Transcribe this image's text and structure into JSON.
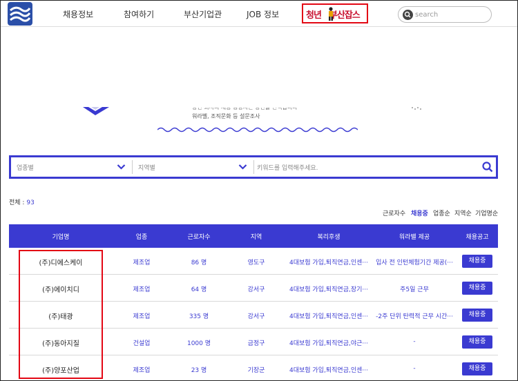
{
  "nav": {
    "items": [
      "채용정보",
      "참여하기",
      "부산기업관",
      "JOB 정보"
    ],
    "highlight_left": "청년",
    "highlight_right": "부산잡스"
  },
  "search": {
    "placeholder": "search"
  },
  "banner": {
    "line1": "당신 회사의 채용 담당자는 당신을 선택합니다",
    "line2": "워라벨, 조직문화 등 설문조사"
  },
  "filter": {
    "industry_placeholder": "업종별",
    "region_placeholder": "지역별",
    "keyword_placeholder": "키워드를 입력해주세요."
  },
  "total": {
    "label": "전체 :",
    "count": "93"
  },
  "sort": [
    "근로자수",
    "채용중",
    "업종순",
    "지역순",
    "기업명순"
  ],
  "table": {
    "headers": [
      "기업명",
      "업종",
      "근로자수",
      "지역",
      "복리후생",
      "워라밸 제공",
      "채용공고"
    ],
    "rows": [
      {
        "name": "(주)디에스케이",
        "industry": "제조업",
        "workers": "86 명",
        "region": "영도구",
        "welfare": "4대보험 가입,퇴직연금,인센···",
        "worklife": "입사 전 인턴체험기간 제공(···",
        "status": "채용중"
      },
      {
        "name": "(주)에이치디",
        "industry": "제조업",
        "workers": "64 명",
        "region": "강서구",
        "welfare": "4대보험 가입,퇴직연금,장기···",
        "worklife": "주5일 근무",
        "status": "채용중"
      },
      {
        "name": "(주)태광",
        "industry": "제조업",
        "workers": "335 명",
        "region": "강서구",
        "welfare": "4대보험 가입,퇴직연금,인센···",
        "worklife": "-2주 단위 탄력적 근무 시간···",
        "status": "채용중"
      },
      {
        "name": "(주)동아지질",
        "industry": "건설업",
        "workers": "1000 명",
        "region": "금정구",
        "welfare": "4대보험 가입,퇴직연금,야근···",
        "worklife": "-",
        "status": "채용중"
      },
      {
        "name": "(주)양포산업",
        "industry": "제조업",
        "workers": "23 명",
        "region": "기장군",
        "welfare": "4대보험 가입,퇴직연금,인센···",
        "worklife": "-",
        "status": "채용중"
      }
    ]
  },
  "colors": {
    "accent": "#3a3ad1",
    "highlight_box": "#e30613"
  }
}
